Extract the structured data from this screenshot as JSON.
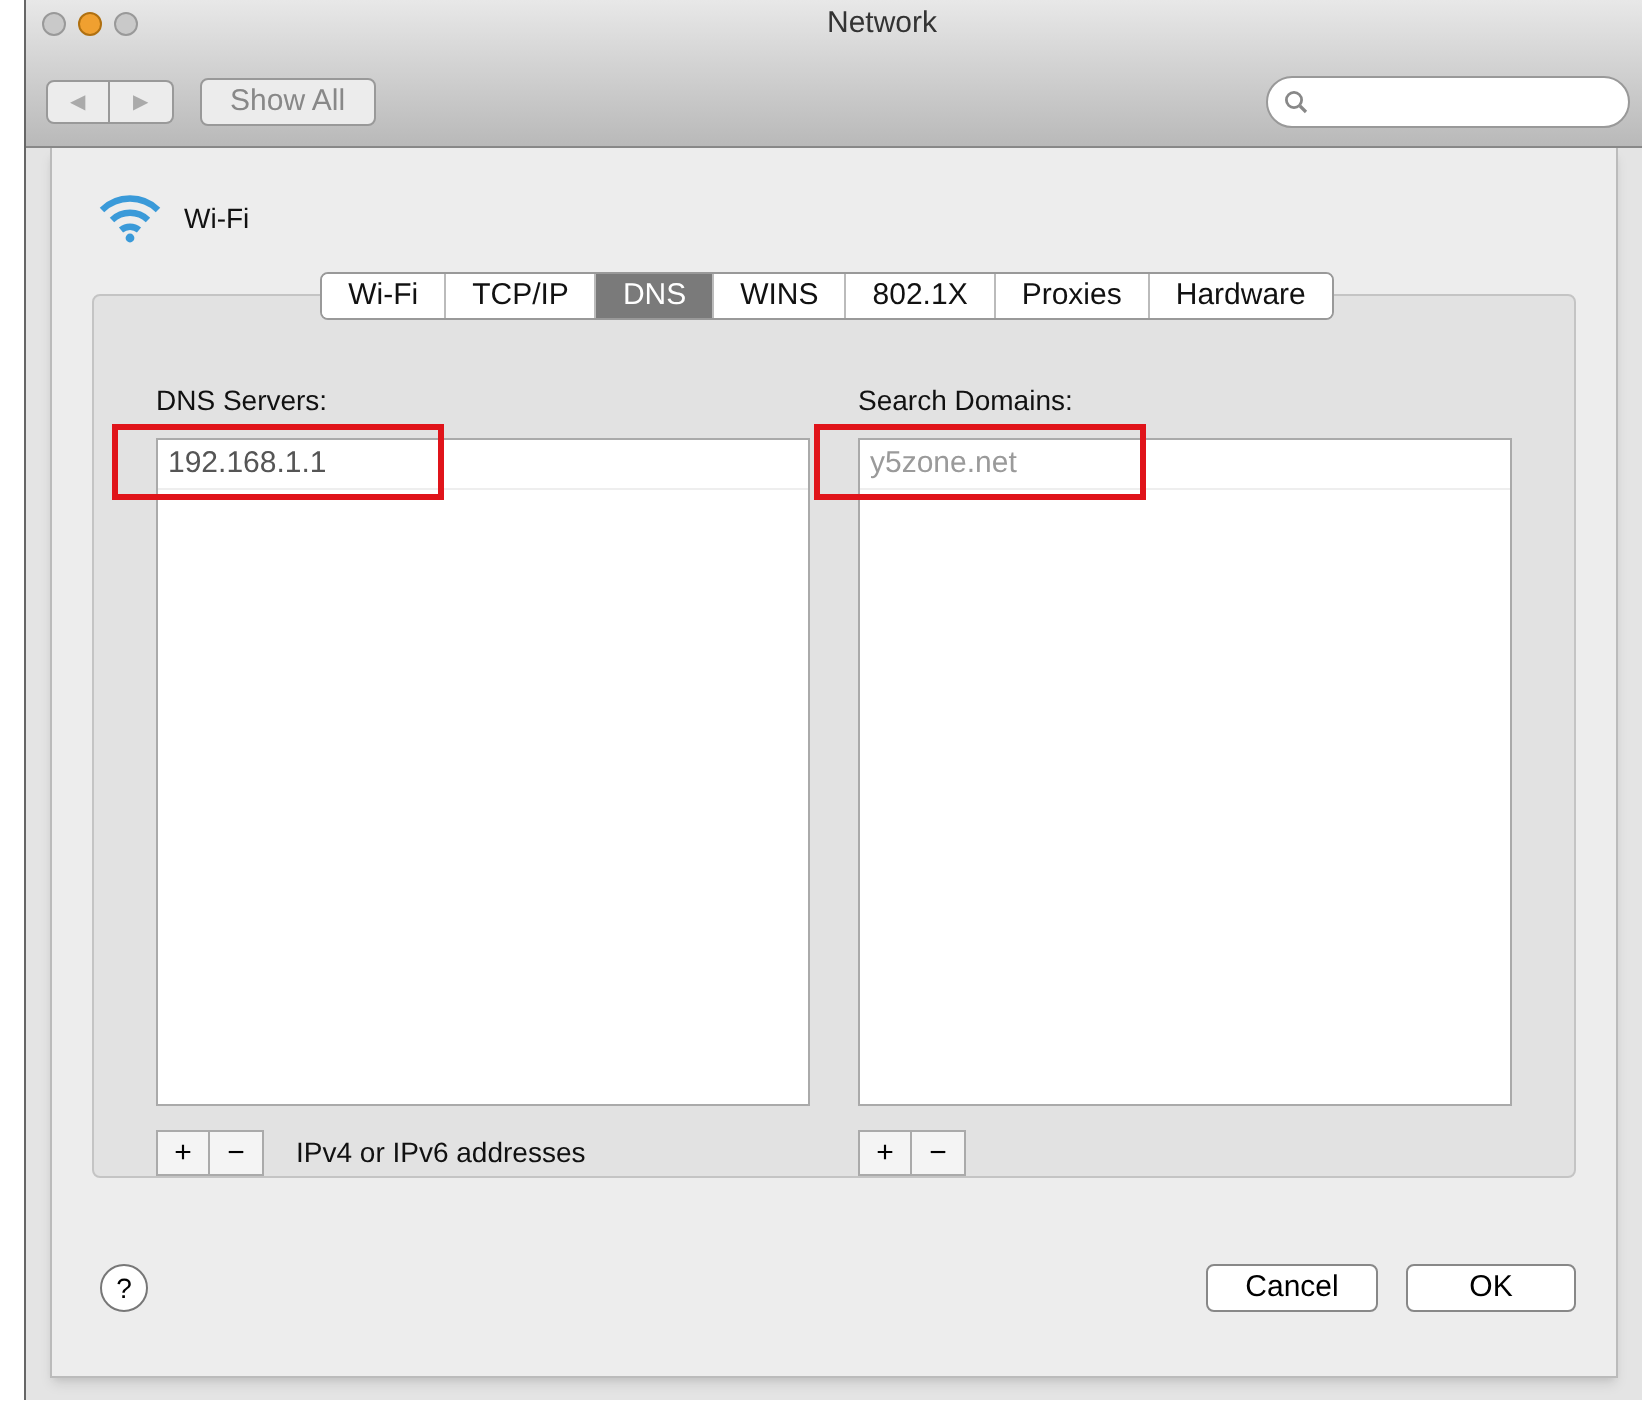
{
  "window": {
    "title": "Network"
  },
  "toolbar": {
    "show_all": "Show All",
    "back": "◀",
    "forward": "▶"
  },
  "interface": {
    "name": "Wi-Fi"
  },
  "tabs": [
    {
      "label": "Wi-Fi",
      "selected": false
    },
    {
      "label": "TCP/IP",
      "selected": false
    },
    {
      "label": "DNS",
      "selected": true
    },
    {
      "label": "WINS",
      "selected": false
    },
    {
      "label": "802.1X",
      "selected": false
    },
    {
      "label": "Proxies",
      "selected": false
    },
    {
      "label": "Hardware",
      "selected": false
    }
  ],
  "dns_servers": {
    "label": "DNS Servers:",
    "entries": [
      {
        "text": "192.168.1.1",
        "faded": false,
        "annotated": true
      }
    ],
    "hint": "IPv4 or IPv6 addresses",
    "add": "+",
    "remove": "−"
  },
  "search_domains": {
    "label": "Search Domains:",
    "entries": [
      {
        "text": "y5zone.net",
        "faded": true,
        "annotated": true
      }
    ],
    "add": "+",
    "remove": "−"
  },
  "buttons": {
    "help": "?",
    "cancel": "Cancel",
    "ok": "OK"
  }
}
